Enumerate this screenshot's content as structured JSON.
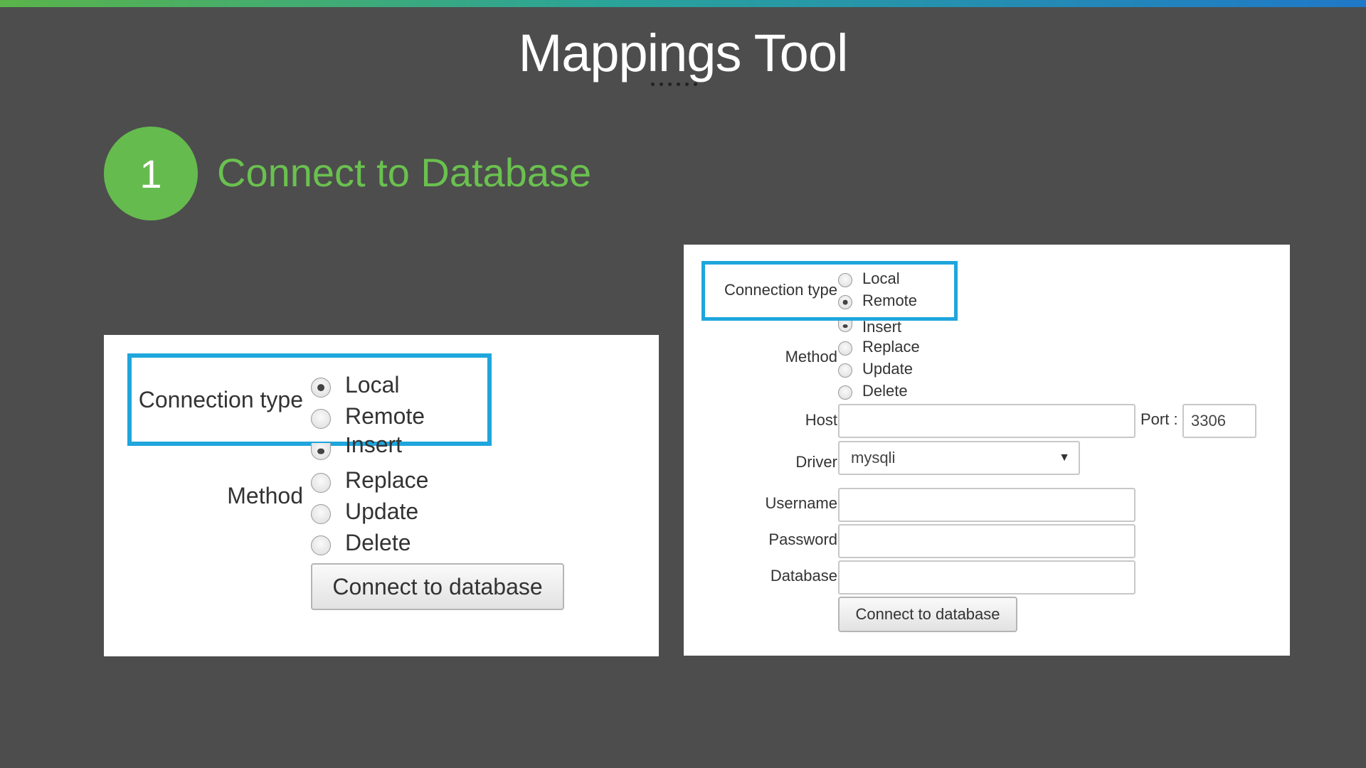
{
  "slide": {
    "title": "Mappings Tool",
    "step_number": "1",
    "step_title": "Connect to Database"
  },
  "left_form": {
    "connection_type_label": "Connection type",
    "connection_options": [
      "Local",
      "Remote"
    ],
    "connection_selected": "Local",
    "method_label": "Method",
    "method_options": [
      "Insert",
      "Replace",
      "Update",
      "Delete"
    ],
    "method_selected": "Insert",
    "connect_button": "Connect to database"
  },
  "right_form": {
    "connection_type_label": "Connection type",
    "connection_options": [
      "Local",
      "Remote"
    ],
    "connection_selected": "Remote",
    "method_label": "Method",
    "method_options": [
      "Insert",
      "Replace",
      "Update",
      "Delete"
    ],
    "method_selected": "Insert",
    "host_label": "Host",
    "host_value": "",
    "port_label": "Port :",
    "port_value": "3306",
    "driver_label": "Driver",
    "driver_value": "mysqli",
    "username_label": "Username",
    "username_value": "",
    "password_label": "Password",
    "password_value": "",
    "database_label": "Database",
    "database_value": "",
    "connect_button": "Connect to database"
  },
  "colors": {
    "background": "#4d4d4d",
    "accent_green": "#66bb4f",
    "highlight_blue": "#1fa6dc"
  }
}
